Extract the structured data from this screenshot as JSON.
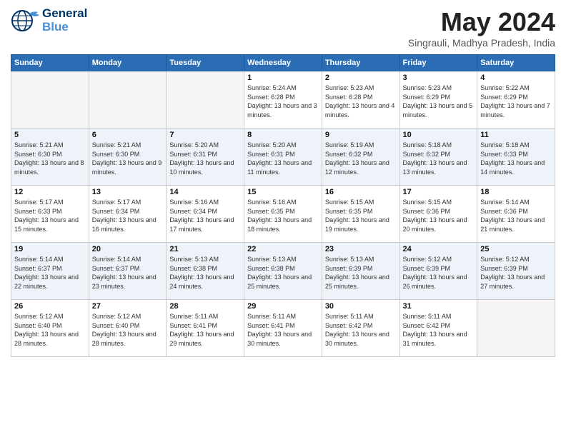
{
  "header": {
    "logo_line1": "General",
    "logo_line2": "Blue",
    "month_title": "May 2024",
    "location": "Singrauli, Madhya Pradesh, India"
  },
  "weekdays": [
    "Sunday",
    "Monday",
    "Tuesday",
    "Wednesday",
    "Thursday",
    "Friday",
    "Saturday"
  ],
  "weeks": [
    [
      {
        "day": "",
        "sunrise": "",
        "sunset": "",
        "daylight": ""
      },
      {
        "day": "",
        "sunrise": "",
        "sunset": "",
        "daylight": ""
      },
      {
        "day": "",
        "sunrise": "",
        "sunset": "",
        "daylight": ""
      },
      {
        "day": "1",
        "sunrise": "Sunrise: 5:24 AM",
        "sunset": "Sunset: 6:28 PM",
        "daylight": "Daylight: 13 hours and 3 minutes."
      },
      {
        "day": "2",
        "sunrise": "Sunrise: 5:23 AM",
        "sunset": "Sunset: 6:28 PM",
        "daylight": "Daylight: 13 hours and 4 minutes."
      },
      {
        "day": "3",
        "sunrise": "Sunrise: 5:23 AM",
        "sunset": "Sunset: 6:29 PM",
        "daylight": "Daylight: 13 hours and 5 minutes."
      },
      {
        "day": "4",
        "sunrise": "Sunrise: 5:22 AM",
        "sunset": "Sunset: 6:29 PM",
        "daylight": "Daylight: 13 hours and 7 minutes."
      }
    ],
    [
      {
        "day": "5",
        "sunrise": "Sunrise: 5:21 AM",
        "sunset": "Sunset: 6:30 PM",
        "daylight": "Daylight: 13 hours and 8 minutes."
      },
      {
        "day": "6",
        "sunrise": "Sunrise: 5:21 AM",
        "sunset": "Sunset: 6:30 PM",
        "daylight": "Daylight: 13 hours and 9 minutes."
      },
      {
        "day": "7",
        "sunrise": "Sunrise: 5:20 AM",
        "sunset": "Sunset: 6:31 PM",
        "daylight": "Daylight: 13 hours and 10 minutes."
      },
      {
        "day": "8",
        "sunrise": "Sunrise: 5:20 AM",
        "sunset": "Sunset: 6:31 PM",
        "daylight": "Daylight: 13 hours and 11 minutes."
      },
      {
        "day": "9",
        "sunrise": "Sunrise: 5:19 AM",
        "sunset": "Sunset: 6:32 PM",
        "daylight": "Daylight: 13 hours and 12 minutes."
      },
      {
        "day": "10",
        "sunrise": "Sunrise: 5:18 AM",
        "sunset": "Sunset: 6:32 PM",
        "daylight": "Daylight: 13 hours and 13 minutes."
      },
      {
        "day": "11",
        "sunrise": "Sunrise: 5:18 AM",
        "sunset": "Sunset: 6:33 PM",
        "daylight": "Daylight: 13 hours and 14 minutes."
      }
    ],
    [
      {
        "day": "12",
        "sunrise": "Sunrise: 5:17 AM",
        "sunset": "Sunset: 6:33 PM",
        "daylight": "Daylight: 13 hours and 15 minutes."
      },
      {
        "day": "13",
        "sunrise": "Sunrise: 5:17 AM",
        "sunset": "Sunset: 6:34 PM",
        "daylight": "Daylight: 13 hours and 16 minutes."
      },
      {
        "day": "14",
        "sunrise": "Sunrise: 5:16 AM",
        "sunset": "Sunset: 6:34 PM",
        "daylight": "Daylight: 13 hours and 17 minutes."
      },
      {
        "day": "15",
        "sunrise": "Sunrise: 5:16 AM",
        "sunset": "Sunset: 6:35 PM",
        "daylight": "Daylight: 13 hours and 18 minutes."
      },
      {
        "day": "16",
        "sunrise": "Sunrise: 5:15 AM",
        "sunset": "Sunset: 6:35 PM",
        "daylight": "Daylight: 13 hours and 19 minutes."
      },
      {
        "day": "17",
        "sunrise": "Sunrise: 5:15 AM",
        "sunset": "Sunset: 6:36 PM",
        "daylight": "Daylight: 13 hours and 20 minutes."
      },
      {
        "day": "18",
        "sunrise": "Sunrise: 5:14 AM",
        "sunset": "Sunset: 6:36 PM",
        "daylight": "Daylight: 13 hours and 21 minutes."
      }
    ],
    [
      {
        "day": "19",
        "sunrise": "Sunrise: 5:14 AM",
        "sunset": "Sunset: 6:37 PM",
        "daylight": "Daylight: 13 hours and 22 minutes."
      },
      {
        "day": "20",
        "sunrise": "Sunrise: 5:14 AM",
        "sunset": "Sunset: 6:37 PM",
        "daylight": "Daylight: 13 hours and 23 minutes."
      },
      {
        "day": "21",
        "sunrise": "Sunrise: 5:13 AM",
        "sunset": "Sunset: 6:38 PM",
        "daylight": "Daylight: 13 hours and 24 minutes."
      },
      {
        "day": "22",
        "sunrise": "Sunrise: 5:13 AM",
        "sunset": "Sunset: 6:38 PM",
        "daylight": "Daylight: 13 hours and 25 minutes."
      },
      {
        "day": "23",
        "sunrise": "Sunrise: 5:13 AM",
        "sunset": "Sunset: 6:39 PM",
        "daylight": "Daylight: 13 hours and 25 minutes."
      },
      {
        "day": "24",
        "sunrise": "Sunrise: 5:12 AM",
        "sunset": "Sunset: 6:39 PM",
        "daylight": "Daylight: 13 hours and 26 minutes."
      },
      {
        "day": "25",
        "sunrise": "Sunrise: 5:12 AM",
        "sunset": "Sunset: 6:39 PM",
        "daylight": "Daylight: 13 hours and 27 minutes."
      }
    ],
    [
      {
        "day": "26",
        "sunrise": "Sunrise: 5:12 AM",
        "sunset": "Sunset: 6:40 PM",
        "daylight": "Daylight: 13 hours and 28 minutes."
      },
      {
        "day": "27",
        "sunrise": "Sunrise: 5:12 AM",
        "sunset": "Sunset: 6:40 PM",
        "daylight": "Daylight: 13 hours and 28 minutes."
      },
      {
        "day": "28",
        "sunrise": "Sunrise: 5:11 AM",
        "sunset": "Sunset: 6:41 PM",
        "daylight": "Daylight: 13 hours and 29 minutes."
      },
      {
        "day": "29",
        "sunrise": "Sunrise: 5:11 AM",
        "sunset": "Sunset: 6:41 PM",
        "daylight": "Daylight: 13 hours and 30 minutes."
      },
      {
        "day": "30",
        "sunrise": "Sunrise: 5:11 AM",
        "sunset": "Sunset: 6:42 PM",
        "daylight": "Daylight: 13 hours and 30 minutes."
      },
      {
        "day": "31",
        "sunrise": "Sunrise: 5:11 AM",
        "sunset": "Sunset: 6:42 PM",
        "daylight": "Daylight: 13 hours and 31 minutes."
      },
      {
        "day": "",
        "sunrise": "",
        "sunset": "",
        "daylight": ""
      }
    ]
  ]
}
